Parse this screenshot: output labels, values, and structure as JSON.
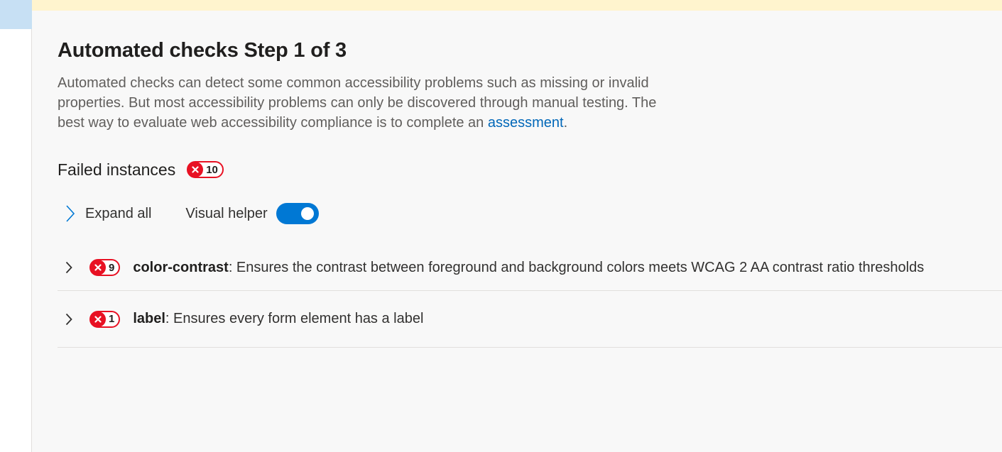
{
  "page": {
    "title": "Automated checks Step 1 of 3",
    "description": "Automated checks can detect some common accessibility problems such as missing or invalid properties. But most accessibility problems can only be discovered through manual testing. The best way to evaluate web accessibility compliance is to complete an ",
    "description_link": "assessment",
    "description_end": "."
  },
  "failed": {
    "heading": "Failed instances",
    "count": "10"
  },
  "controls": {
    "expand_all": "Expand all",
    "visual_helper": "Visual helper",
    "visual_helper_on": true
  },
  "rules": [
    {
      "count": "9",
      "id": "color-contrast",
      "description": ": Ensures the contrast between foreground and background colors meets WCAG 2 AA contrast ratio thresholds"
    },
    {
      "count": "1",
      "id": "label",
      "description": ": Ensures every form element has a label"
    }
  ],
  "colors": {
    "accent": "#0078d4",
    "link": "#0067b8",
    "error": "#e81123",
    "banner": "#fff4ce"
  },
  "icons": {
    "chevron": "chevron-right-icon",
    "failure": "error-x-icon"
  }
}
